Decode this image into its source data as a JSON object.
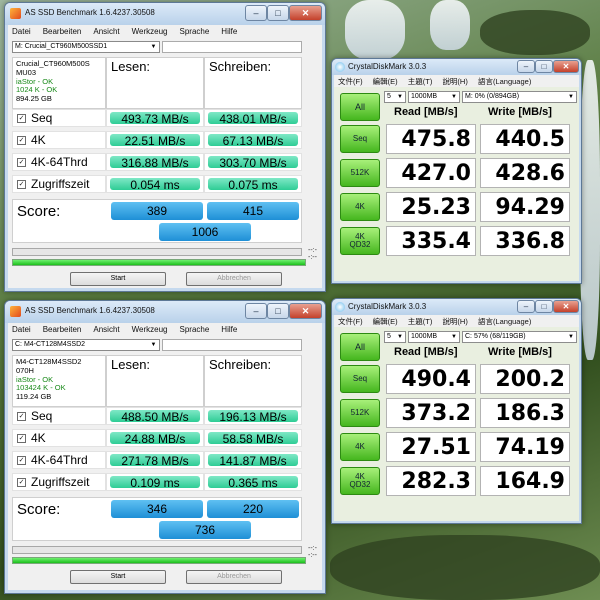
{
  "as_ssd": [
    {
      "title": "AS SSD Benchmark 1.6.4237.30508",
      "menu": [
        "Datei",
        "Bearbeiten",
        "Ansicht",
        "Werkzeug",
        "Sprache",
        "Hilfe"
      ],
      "drive": "M: Crucial_CT960M500SSD1",
      "info": {
        "model": "Crucial_CT960M500S",
        "firmware": "MU03",
        "driver": "iaStor - OK",
        "align": "1024 K - OK",
        "size": "894.25 GB"
      },
      "read_header": "Lesen:",
      "write_header": "Schreiben:",
      "rows": [
        {
          "label": "Seq",
          "read": "493.73 MB/s",
          "write": "438.01 MB/s"
        },
        {
          "label": "4K",
          "read": "22.51 MB/s",
          "write": "67.13 MB/s"
        },
        {
          "label": "4K-64Thrd",
          "read": "316.88 MB/s",
          "write": "303.70 MB/s"
        },
        {
          "label": "Zugriffszeit",
          "read": "0.054 ms",
          "write": "0.075 ms"
        }
      ],
      "score_label": "Score:",
      "score_read": "389",
      "score_write": "415",
      "score_total": "1006",
      "time_display": "--:--:--",
      "start_label": "Start",
      "abort_label": "Abbrechen"
    },
    {
      "title": "AS SSD Benchmark 1.6.4237.30508",
      "menu": [
        "Datei",
        "Bearbeiten",
        "Ansicht",
        "Werkzeug",
        "Sprache",
        "Hilfe"
      ],
      "drive": "C: M4-CT128M4SSD2",
      "info": {
        "model": "M4-CT128M4SSD2",
        "firmware": "070H",
        "driver": "iaStor - OK",
        "align": "103424 K - OK",
        "size": "119.24 GB"
      },
      "read_header": "Lesen:",
      "write_header": "Schreiben:",
      "rows": [
        {
          "label": "Seq",
          "read": "488.50 MB/s",
          "write": "196.13 MB/s"
        },
        {
          "label": "4K",
          "read": "24.88 MB/s",
          "write": "58.58 MB/s"
        },
        {
          "label": "4K-64Thrd",
          "read": "271.78 MB/s",
          "write": "141.87 MB/s"
        },
        {
          "label": "Zugriffszeit",
          "read": "0.109 ms",
          "write": "0.365 ms"
        }
      ],
      "score_label": "Score:",
      "score_read": "346",
      "score_write": "220",
      "score_total": "736",
      "time_display": "--:--:--",
      "start_label": "Start",
      "abort_label": "Abbrechen"
    }
  ],
  "cdm": [
    {
      "title": "CrystalDiskMark 3.0.3",
      "menu": [
        "文件(F)",
        "編輯(E)",
        "主題(T)",
        "說明(H)",
        "語言(Language)"
      ],
      "all_label": "All",
      "runs": "5",
      "size": "1000MB",
      "drive": "M: 0% (0/894GB)",
      "read_header": "Read [MB/s]",
      "write_header": "Write [MB/s]",
      "rows": [
        {
          "label": "Seq",
          "read": "475.8",
          "write": "440.5"
        },
        {
          "label": "512K",
          "read": "427.0",
          "write": "428.6"
        },
        {
          "label": "4K",
          "read": "25.23",
          "write": "94.29"
        },
        {
          "label": "4K\nQD32",
          "read": "335.4",
          "write": "336.8"
        }
      ]
    },
    {
      "title": "CrystalDiskMark 3.0.3",
      "menu": [
        "文件(F)",
        "編輯(E)",
        "主題(T)",
        "說明(H)",
        "語言(Language)"
      ],
      "all_label": "All",
      "runs": "5",
      "size": "1000MB",
      "drive": "C: 57% (68/119GB)",
      "read_header": "Read [MB/s]",
      "write_header": "Write [MB/s]",
      "rows": [
        {
          "label": "Seq",
          "read": "490.4",
          "write": "200.2"
        },
        {
          "label": "512K",
          "read": "373.2",
          "write": "186.3"
        },
        {
          "label": "4K",
          "read": "27.51",
          "write": "74.19"
        },
        {
          "label": "4K\nQD32",
          "read": "282.3",
          "write": "164.9"
        }
      ]
    }
  ]
}
